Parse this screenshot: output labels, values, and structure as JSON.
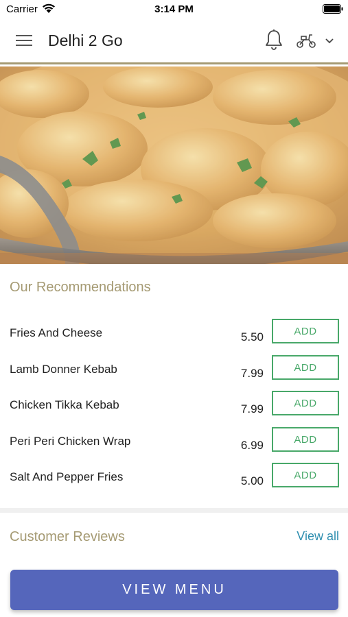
{
  "status_bar": {
    "carrier": "Carrier",
    "time": "3:14 PM"
  },
  "header": {
    "title": "Delhi 2 Go",
    "icons": [
      "menu-icon",
      "bell-icon",
      "scooter-icon",
      "chevron-down-icon"
    ],
    "accent_color": "#a59a73"
  },
  "hero": {
    "image": "curry-dish-photo"
  },
  "recommendations": {
    "title": "Our Recommendations",
    "items": [
      {
        "name": "Fries And Cheese",
        "price": "5.50",
        "add_label": "ADD"
      },
      {
        "name": "Lamb Donner Kebab",
        "price": "7.99",
        "add_label": "ADD"
      },
      {
        "name": "Chicken Tikka Kebab",
        "price": "7.99",
        "add_label": "ADD"
      },
      {
        "name": "Peri Peri Chicken Wrap",
        "price": "6.99",
        "add_label": "ADD"
      },
      {
        "name": "Salt And Pepper Fries",
        "price": "5.00",
        "add_label": "ADD"
      }
    ],
    "add_color": "#48a869"
  },
  "reviews": {
    "title": "Customer Reviews",
    "view_all": "View all"
  },
  "footer": {
    "view_menu": "VIEW MENU",
    "button_color": "#5566bb"
  }
}
